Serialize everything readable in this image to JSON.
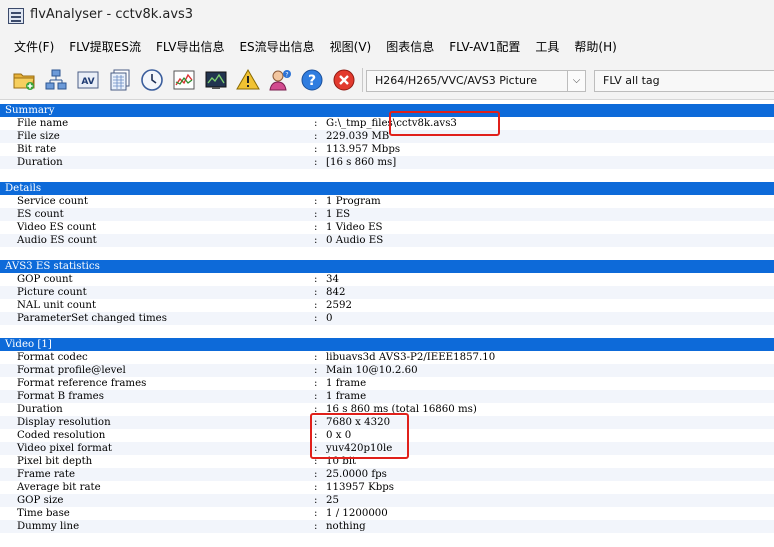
{
  "window": {
    "title": "flvAnalyser - cctv8k.avs3"
  },
  "menu": [
    "文件(F)",
    "FLV提取ES流",
    "FLV导出信息",
    "ES流导出信息",
    "视图(V)",
    "图表信息",
    "FLV-AV1配置",
    "工具",
    "帮助(H)"
  ],
  "toolbar": {
    "icons": [
      "folder-open-icon",
      "network-tree-icon",
      "av-icon",
      "documents-grid-icon",
      "clock-icon",
      "line-chart-icon",
      "video-monitor-icon",
      "warning-icon",
      "user-help-icon",
      "help-icon",
      "close-icon"
    ],
    "codec_select": "H264/H265/VVC/AVS3 Picture",
    "tag_select": "FLV all tag"
  },
  "report": {
    "sections": [
      {
        "title": "Summary",
        "rows": [
          {
            "key": "File name",
            "value": "G:\\_tmp_files\\cctv8k.avs3"
          },
          {
            "key": "File size",
            "value": "229.039 MB"
          },
          {
            "key": "Bit rate",
            "value": "113.957 Mbps"
          },
          {
            "key": "Duration",
            "value": "[16 s 860 ms]"
          }
        ]
      },
      {
        "title": "Details",
        "rows": [
          {
            "key": "Service count",
            "value": "1 Program"
          },
          {
            "key": "ES count",
            "value": "1 ES"
          },
          {
            "key": "Video ES count",
            "value": "1 Video ES"
          },
          {
            "key": "Audio ES count",
            "value": "0 Audio ES"
          }
        ]
      },
      {
        "title": "AVS3 ES statistics",
        "rows": [
          {
            "key": "GOP count",
            "value": "34"
          },
          {
            "key": "Picture count",
            "value": "842"
          },
          {
            "key": "NAL unit count",
            "value": "2592"
          },
          {
            "key": "ParameterSet changed times",
            "value": "0"
          }
        ]
      },
      {
        "title": "Video [1]",
        "rows": [
          {
            "key": "Format codec",
            "value": "libuavs3d AVS3-P2/IEEE1857.10"
          },
          {
            "key": "Format profile@level",
            "value": "Main 10@10.2.60"
          },
          {
            "key": "Format reference frames",
            "value": "1 frame"
          },
          {
            "key": "Format B frames",
            "value": "1 frame"
          },
          {
            "key": "Duration",
            "value": "16 s 860 ms (total 16860 ms)"
          },
          {
            "key": "Display resolution",
            "value": "7680 x 4320"
          },
          {
            "key": "Coded resolution",
            "value": "0 x 0"
          },
          {
            "key": "Video pixel format",
            "value": "yuv420p10le"
          },
          {
            "key": "Pixel bit depth",
            "value": "10 bit"
          },
          {
            "key": "Frame rate",
            "value": "25.0000 fps"
          },
          {
            "key": "Average bit rate",
            "value": "113957 Kbps"
          },
          {
            "key": "GOP size",
            "value": "25"
          },
          {
            "key": "Time base",
            "value": "1 / 1200000"
          },
          {
            "key": "Dummy line",
            "value": "nothing"
          }
        ]
      }
    ]
  },
  "colors": {
    "section_bg": "#0d6ad9",
    "highlight_box": "#e0201b"
  }
}
